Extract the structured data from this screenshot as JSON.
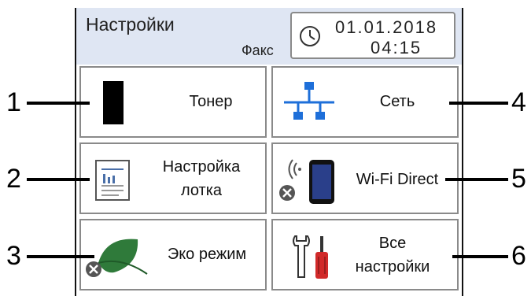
{
  "header": {
    "title": "Настройки",
    "mode": "Факс",
    "date": "01.01.2018",
    "time": "04:15"
  },
  "tiles": [
    {
      "label": "Тонер"
    },
    {
      "label": "Сеть"
    },
    {
      "label": "Настройка лотка"
    },
    {
      "label": "Wi-Fi Direct"
    },
    {
      "label": "Эко режим"
    },
    {
      "label": "Все настройки"
    }
  ],
  "callouts": [
    "1",
    "2",
    "3",
    "4",
    "5",
    "6"
  ],
  "colors": {
    "header_bg": "#dfe6f3",
    "network_blue": "#1e6fd9",
    "leaf_green": "#2f7a3a",
    "status_gray": "#555555",
    "screwdriver_red": "#d12a2a"
  }
}
